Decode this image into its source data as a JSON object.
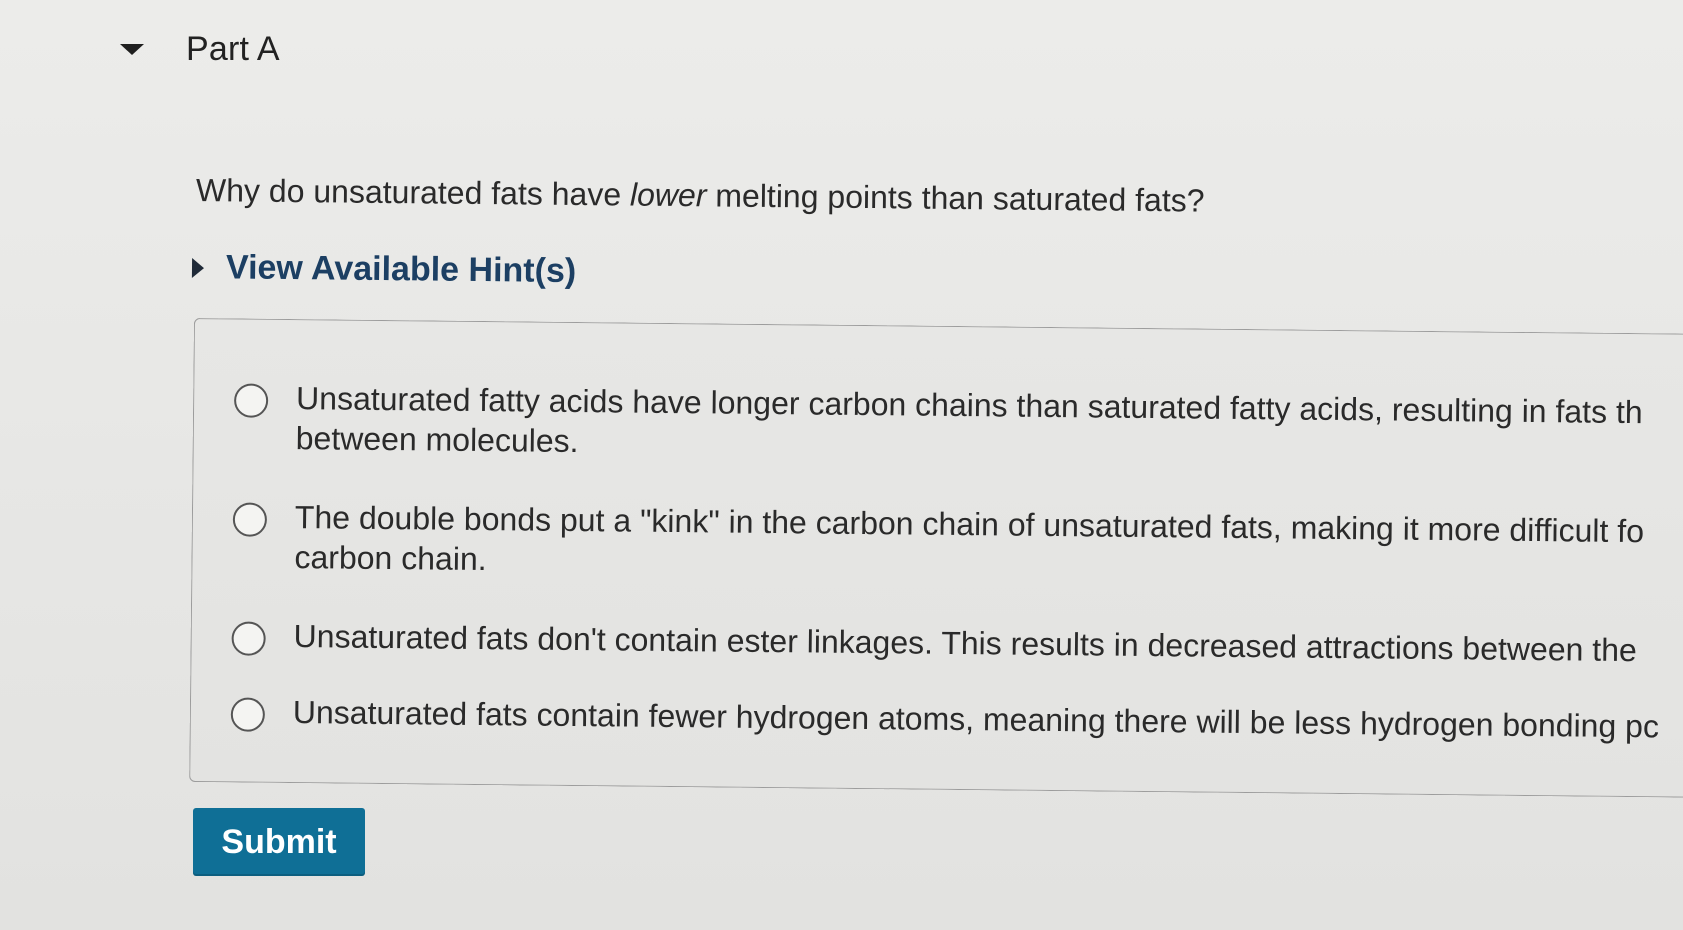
{
  "part": {
    "title": "Part A",
    "toggle_icon": "caret-down-icon"
  },
  "question": {
    "prefix": "Why do unsaturated fats have ",
    "emphasis": "lower",
    "suffix": " melting points than saturated fats?"
  },
  "hints": {
    "label": "View Available Hint(s)",
    "icon": "caret-right-icon"
  },
  "options": [
    {
      "text": "Unsaturated fatty acids have longer carbon chains than saturated fatty acids, resulting in fats th between molecules."
    },
    {
      "text": "The double bonds put a \"kink\" in the carbon chain of unsaturated fats, making it more difficult fo carbon chain."
    },
    {
      "text": "Unsaturated fats don't contain ester linkages. This results in decreased attractions between the"
    },
    {
      "text": "Unsaturated fats contain fewer hydrogen atoms, meaning there will be less hydrogen bonding pc"
    }
  ],
  "submit": {
    "label": "Submit",
    "color": "#0f6f96"
  }
}
